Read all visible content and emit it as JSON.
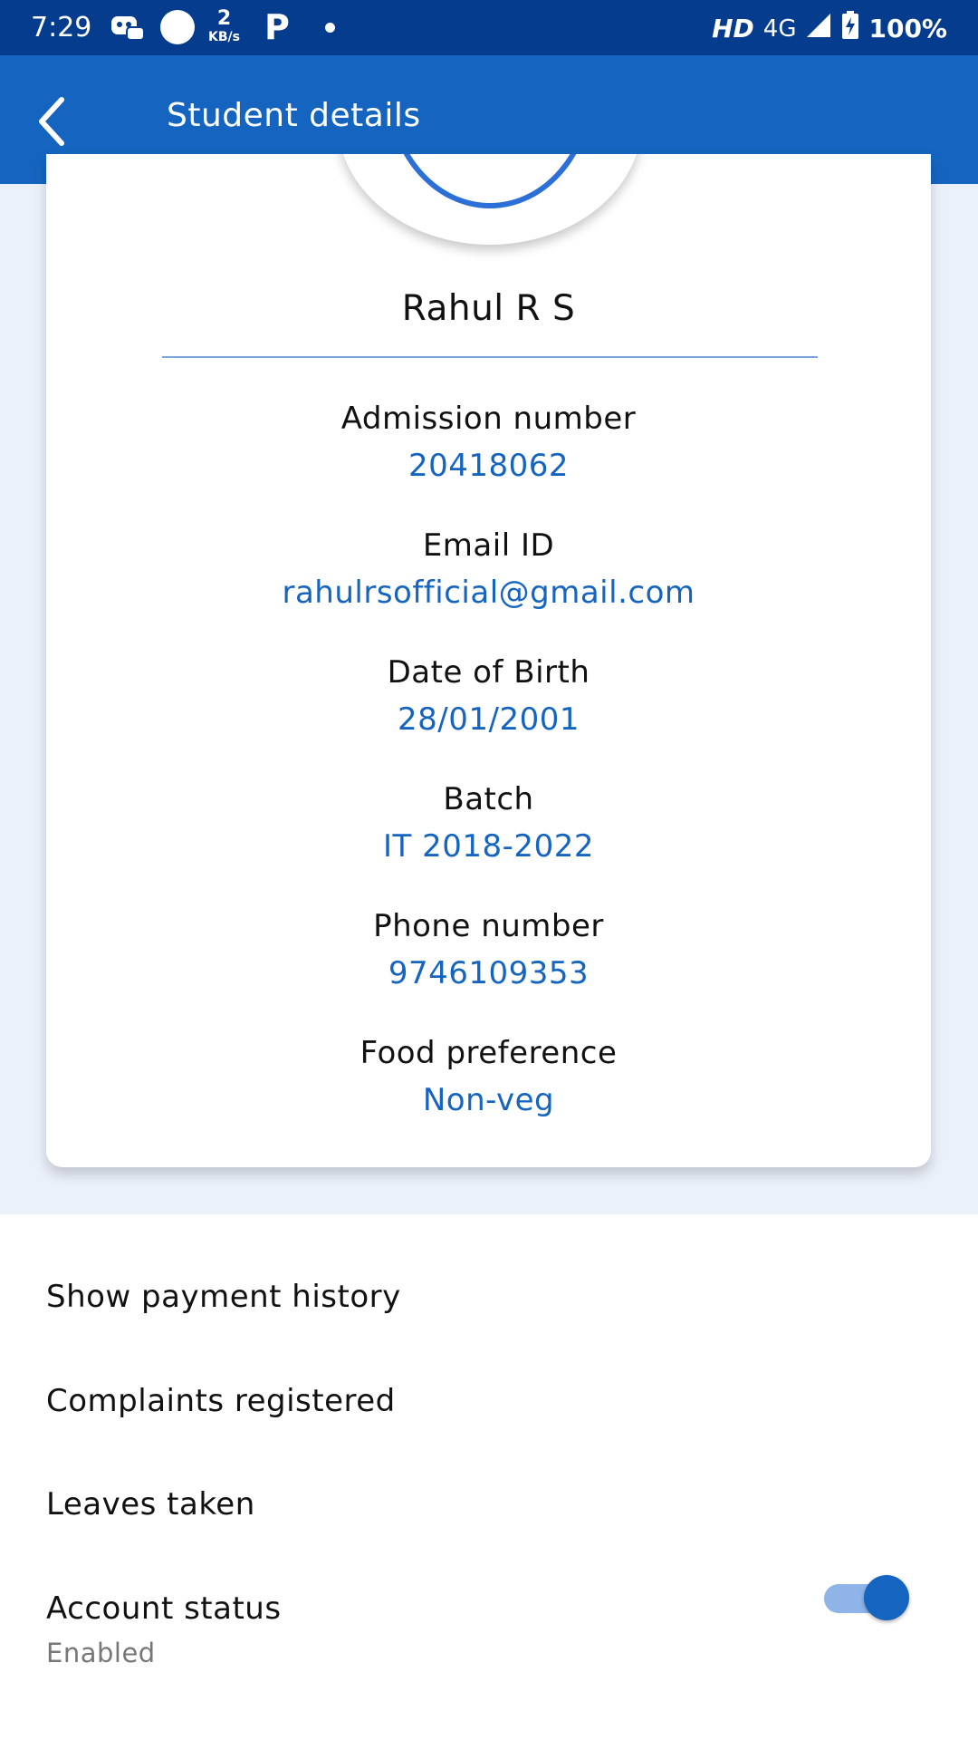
{
  "status_bar": {
    "time": "7:29",
    "net_speed_value": "2",
    "net_speed_unit": "KB/s",
    "network_hd": "HD",
    "network_type": "4G",
    "battery": "100%"
  },
  "app_bar": {
    "title": "Student details"
  },
  "profile": {
    "name": "Rahul R S",
    "fields": [
      {
        "label": "Admission number",
        "value": "20418062"
      },
      {
        "label": "Email ID",
        "value": "rahulrsofficial@gmail.com"
      },
      {
        "label": "Date of Birth",
        "value": "28/01/2001"
      },
      {
        "label": "Batch",
        "value": "IT 2018-2022"
      },
      {
        "label": "Phone number",
        "value": "9746109353"
      },
      {
        "label": "Food preference",
        "value": "Non-veg"
      }
    ]
  },
  "actions": {
    "payment_history": "Show payment history",
    "complaints": "Complaints registered",
    "leaves": "Leaves taken",
    "account_status": {
      "label": "Account status",
      "status": "Enabled",
      "enabled": true
    }
  },
  "colors": {
    "status_bar": "#063c8e",
    "app_bar": "#1565c0",
    "value_text": "#1565c0",
    "background": "#ebf1fb"
  }
}
